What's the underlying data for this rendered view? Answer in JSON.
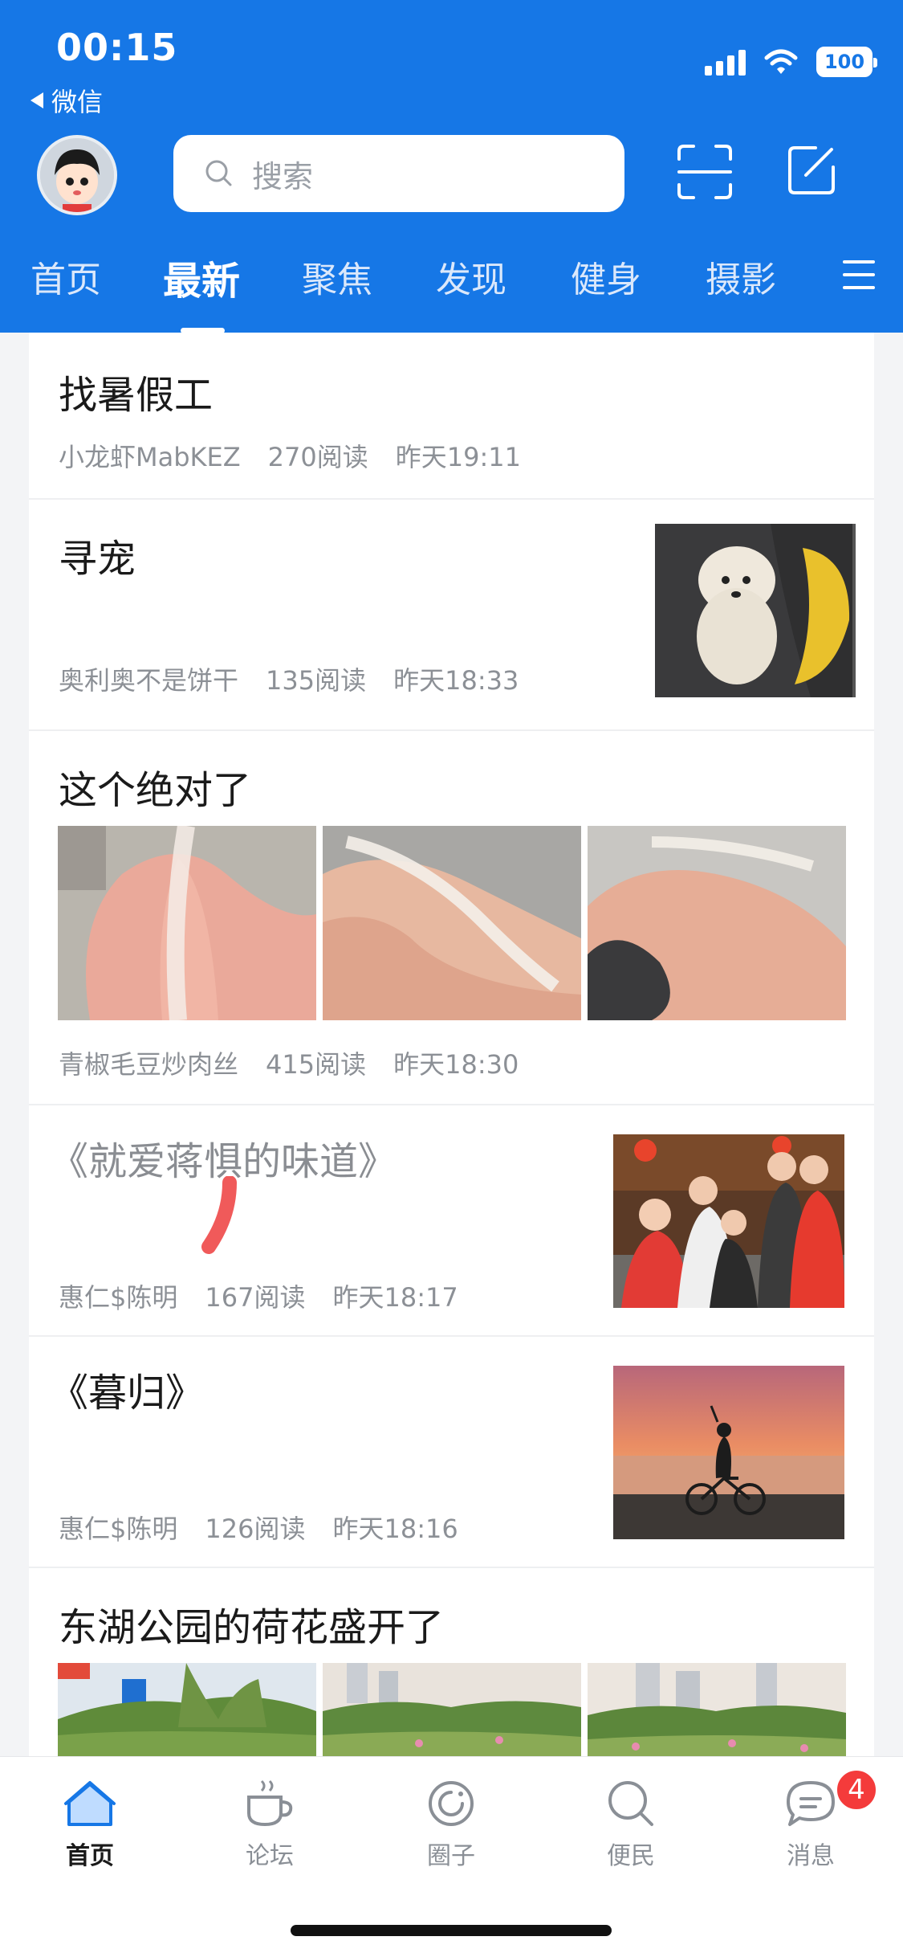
{
  "status_bar": {
    "time": "00:15",
    "back_app": "微信",
    "battery": "100"
  },
  "header": {
    "search_placeholder": "搜索",
    "avatar": "cartoon-avatar",
    "scan_icon": "scan-icon",
    "edit_icon": "compose-icon"
  },
  "tabs": [
    {
      "label": "首页"
    },
    {
      "label": "最新",
      "active": true
    },
    {
      "label": "聚焦"
    },
    {
      "label": "发现"
    },
    {
      "label": "健身"
    },
    {
      "label": "摄影"
    }
  ],
  "posts": [
    {
      "title": "找暑假工",
      "author": "小龙虾MabKEZ",
      "reads": "270阅读",
      "time": "昨天19:11"
    },
    {
      "title": "寻宠",
      "author": "奥利奥不是饼干",
      "reads": "135阅读",
      "time": "昨天18:33"
    },
    {
      "title": "这个绝对了",
      "author": "青椒毛豆炒肉丝",
      "reads": "415阅读",
      "time": "昨天18:30"
    },
    {
      "title": "《就爱蒋惧的味道》",
      "author": "惠仁$陈明",
      "reads": "167阅读",
      "time": "昨天18:17"
    },
    {
      "title": "《暮归》",
      "author": "惠仁$陈明",
      "reads": "126阅读",
      "time": "昨天18:16"
    },
    {
      "title": "东湖公园的荷花盛开了"
    }
  ],
  "bottom_nav": [
    {
      "label": "首页",
      "icon": "home-icon",
      "active": true
    },
    {
      "label": "论坛",
      "icon": "coffee-cup-icon"
    },
    {
      "label": "圈子",
      "icon": "circle-icon"
    },
    {
      "label": "便民",
      "icon": "search-icon"
    },
    {
      "label": "消息",
      "icon": "message-icon",
      "badge": "4"
    }
  ],
  "colors": {
    "brand": "#1677e6",
    "badge": "#f43b3b"
  }
}
